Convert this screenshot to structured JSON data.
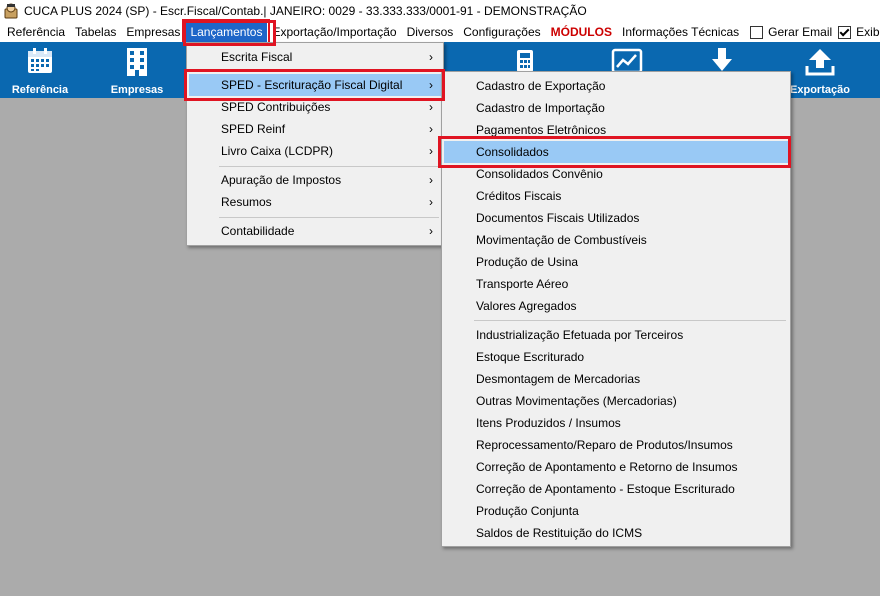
{
  "window": {
    "title": "CUCA PLUS 2024 (SP) - Escr.Fiscal/Contab.| JANEIRO: 0029 - 33.333.333/0001-91 - DEMONSTRAÇÃO",
    "app_icon": "app-logo-icon"
  },
  "menubar": {
    "items": [
      "Referência",
      "Tabelas",
      "Empresas",
      "Lançamentos",
      "Exportação/Importação",
      "Diversos",
      "Configurações",
      "MÓDULOS",
      "Informações Técnicas"
    ],
    "active": "Lançamentos",
    "checkboxes": [
      {
        "label": "Gerar Email",
        "checked": false
      },
      {
        "label": "Exibir",
        "checked": true
      }
    ]
  },
  "toolbar": {
    "buttons": [
      {
        "label": "Referência",
        "icon": "calendar-icon"
      },
      {
        "label": "Empresas",
        "icon": "building-icon"
      },
      {
        "label": "",
        "icon": "calculator-icon"
      },
      {
        "label": "",
        "icon": "chart-icon"
      },
      {
        "label": "",
        "icon": "download-arrow-icon"
      },
      {
        "label": "Exportação",
        "icon": "upload-icon"
      }
    ],
    "color": "#0a68b0"
  },
  "lancamentos_menu": {
    "items": [
      {
        "label": "Escrita Fiscal",
        "submenu": true
      },
      {
        "label": "SPED - Escrituração Fiscal Digital",
        "submenu": true,
        "highlighted": true
      },
      {
        "label": "SPED Contribuições",
        "submenu": true
      },
      {
        "label": "SPED Reinf",
        "submenu": true
      },
      {
        "label": "Livro Caixa (LCDPR)",
        "submenu": true
      },
      {
        "label": "Apuração de Impostos",
        "submenu": true
      },
      {
        "label": "Resumos",
        "submenu": true
      },
      {
        "label": "Contabilidade",
        "submenu": true
      }
    ]
  },
  "sped_submenu": {
    "items": [
      "Cadastro de Exportação",
      "Cadastro de Importação",
      "Pagamentos Eletrônicos",
      "Consolidados",
      "Consolidados Convênio",
      "Créditos Fiscais",
      "Documentos Fiscais Utilizados",
      "Movimentação de Combustíveis",
      "Produção de Usina",
      "Transporte Aéreo",
      "Valores Agregados",
      "Industrialização Efetuada por Terceiros",
      "Estoque Escriturado",
      "Desmontagem de Mercadorias",
      "Outras Movimentações (Mercadorias)",
      "Itens Produzidos / Insumos",
      "Reprocessamento/Reparo de Produtos/Insumos",
      "Correção de Apontamento e Retorno de Insumos",
      "Correção de Apontamento - Estoque Escriturado",
      "Produção Conjunta",
      "Saldos de Restituição do ICMS"
    ],
    "highlighted": "Consolidados"
  },
  "colors": {
    "highlight": "#99c9f5",
    "annotation_red": "#e01422",
    "modulos": "#cc0000",
    "background": "#ababab"
  }
}
